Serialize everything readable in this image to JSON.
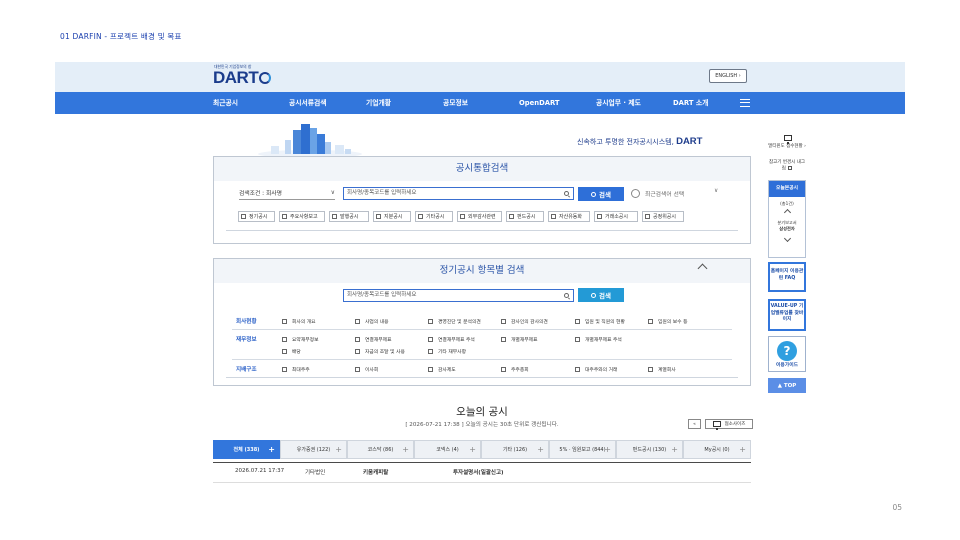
{
  "slide": {
    "title": "01 DARFIN - 프로젝트 배경 및 목표",
    "page_number": "05"
  },
  "header": {
    "logo_sub": "대한민국 기업정보의 창",
    "logo_text": "DART",
    "english_label": "ENGLISH",
    "english_arrow": "›",
    "tagline": "신속하고 투명한 전자공시시스템,",
    "tagline_brand": "DART"
  },
  "nav": {
    "items": [
      "최근공시",
      "공시서류검색",
      "기업개황",
      "공모정보",
      "OpenDART",
      "공시업무 · 제도",
      "DART 소개"
    ]
  },
  "integrated_search": {
    "title": "공시통합검색",
    "condition": "검색조건 : 회사명",
    "placeholder": "회사명/종목코드를 입력하세요",
    "search_label": "검색",
    "recent_label": "최근검색어 선택",
    "filters": [
      "정기공시",
      "주요사항보고",
      "발행공시",
      "지분공시",
      "기타공시",
      "외부감사관련",
      "펀드공시",
      "자산유동화",
      "거래소공시",
      "공정위공시"
    ]
  },
  "item_search": {
    "title": "정기공시 항목별 검색",
    "placeholder": "회사명/종목코드를 입력하세요",
    "search_label": "검색",
    "categories": [
      {
        "label": "회사현황",
        "items": [
          "회사의 개요",
          "사업의 내용",
          "경영진단 및 분석의견",
          "감사인의 감사의견",
          "임원 및 직원의 현황",
          "임원의 보수 등"
        ]
      },
      {
        "label": "재무정보",
        "items": [
          "요약재무정보",
          "연결재무제표",
          "연결재무제표 주석",
          "개별재무제표",
          "개별재무제표 주석",
          "배당",
          "자금의 조달 및 사용",
          "기타 재무사항"
        ]
      },
      {
        "label": "지배구조",
        "items": [
          "최대주주",
          "이사회",
          "감사제도",
          "주주총회",
          "대주주와의 거래",
          "계열회사"
        ]
      }
    ]
  },
  "today": {
    "title": "오늘의 공시",
    "subtitle": "[ 2026-07-21 17:38 ] 오늘의 공시는 30초 단위로 갱신됩니다.",
    "btn_small": "«",
    "btn_view": "협소사이즈",
    "tabs": [
      "전체 (338)",
      "유가증권 (122)",
      "코스닥 (86)",
      "코넥스 (4)",
      "기타 (126)",
      "5% · 임원보고 (844)",
      "펀드공시 (130)",
      "My공시 (0)"
    ],
    "row": [
      "2026.07.21 17:37",
      "기타법인",
      "키움캐피탈",
      "투자설명서(일괄신고)"
    ]
  },
  "side": {
    "monitor_text": "멀티윈도 접수현황 ›",
    "bookmark_text": "참고기 번경시 내그림",
    "recent_head": "오늘본공시",
    "recent_count": "(총1건)",
    "recent_type": "분기보고서",
    "recent_company": "삼성전자",
    "faq": "홈페이지 이용관련 FAQ",
    "valueup": "VALUE-UP 기업밸류업를 찾바이지",
    "guide": "이용가이드",
    "top": "TOP"
  }
}
